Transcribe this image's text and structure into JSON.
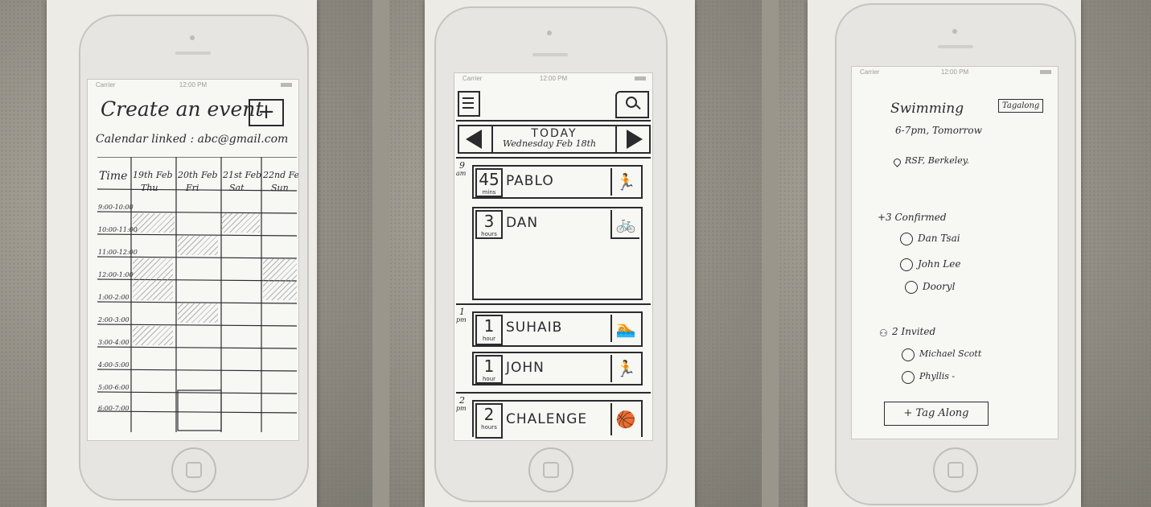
{
  "screen1": {
    "status": {
      "carrier": "Carrier",
      "time": "12:00 PM"
    },
    "title": "Create an event",
    "add_label": "+",
    "calendar_linked": "Calendar linked : abc@gmail.com",
    "time_header": "Time",
    "days": [
      {
        "date": "19th Feb",
        "day": "Thu"
      },
      {
        "date": "20th Feb",
        "day": "Fri"
      },
      {
        "date": "21st Feb",
        "day": "Sat"
      },
      {
        "date": "22nd Feb",
        "day": "Sun"
      }
    ],
    "slots": [
      "9:00-10:00",
      "10:00-11:00",
      "11:00-12:00",
      "12:00-1:00",
      "1:00-2:00",
      "2:00-3:00",
      "3:00-4:00",
      "4:00-5:00",
      "5:00-6:00",
      "6:00-7:00"
    ]
  },
  "screen2": {
    "status": {
      "carrier": "Carrier",
      "time": "12:00 PM"
    },
    "today": "TODAY",
    "date": "Wednesday Feb 18th",
    "hour_labels": [
      {
        "hour": "9",
        "period": "am"
      },
      {
        "hour": "1",
        "period": "pm"
      },
      {
        "hour": "2",
        "period": "pm"
      }
    ],
    "events": [
      {
        "amount": "45",
        "unit": "mins",
        "name": "PABLO",
        "activity": "running"
      },
      {
        "amount": "3",
        "unit": "hours",
        "name": "DAN",
        "activity": "cycling"
      },
      {
        "amount": "1",
        "unit": "hour",
        "name": "SUHAIB",
        "activity": "swimming"
      },
      {
        "amount": "1",
        "unit": "hour",
        "name": "JOHN",
        "activity": "running"
      },
      {
        "amount": "2",
        "unit": "hours",
        "name": "CHALENGE",
        "activity": "basketball"
      }
    ]
  },
  "screen3": {
    "status": {
      "carrier": "Carrier",
      "time": "12:00 PM"
    },
    "activity": "Swimming",
    "tag_badge": "Tagalong",
    "when": "6-7pm, Tomorrow",
    "location": "RSF, Berkeley.",
    "confirmed_label": "+3 Confirmed",
    "confirmed": [
      "Dan Tsai",
      "John Lee",
      "Dooryl"
    ],
    "invited_label": "2 Invited",
    "invited": [
      "Michael Scott",
      "Phyllis -"
    ],
    "tag_along_button": "+ Tag Along"
  }
}
